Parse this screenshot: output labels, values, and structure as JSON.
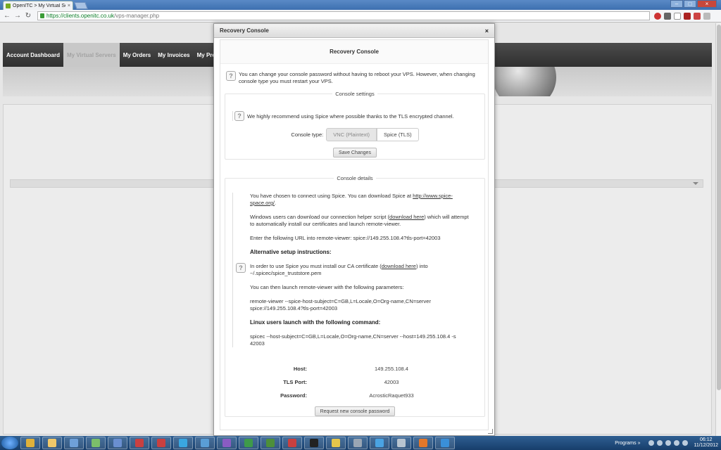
{
  "browser": {
    "tab_title": "OpenITC > My Virtual Serv",
    "tab_close": "×",
    "url_host": "https://clients.openitc.co.uk",
    "url_path": "/vps-manager.php",
    "back": "←",
    "forward": "→",
    "reload": "↻",
    "minimize": "–",
    "maximize": "□",
    "close": "×"
  },
  "nav": {
    "items": [
      {
        "label": "Account Dashboard"
      },
      {
        "label": "My Virtual Servers"
      },
      {
        "label": "My Orders"
      },
      {
        "label": "My Invoices"
      },
      {
        "label": "My Pref"
      }
    ]
  },
  "modal": {
    "header_title": "Recovery Console",
    "close": "×",
    "inner_title": "Recovery Console",
    "intro": "You can change your console password without having to reboot your VPS. However, when changing console type you must restart your VPS.",
    "info_glyph": "?",
    "settings": {
      "legend": "Console settings",
      "recommend": "We highly recommend using Spice where possible thanks to the TLS encrypted channel.",
      "type_label": "Console type:",
      "option_vnc": "VNC (Plaintext)",
      "option_spice": "Spice (TLS)",
      "save_label": "Save Changes"
    },
    "details": {
      "legend": "Console details",
      "p1_pre": "You have chosen to connect using Spice. You can download Spice at ",
      "p1_link": "http://www.spice-space.org/",
      "p1_post": ".",
      "p2_pre": "Windows users can download our connection helper script (",
      "p2_link": "download here",
      "p2_post": ") which will attempt to automatically install our certificates and launch remote-viewer.",
      "p3": "Enter the following URL into remote-viewer: spice://149.255.108.4?tls-port=42003",
      "h_alt": "Alternative setup instructions:",
      "p4_pre": "In order to use Spice you must install our CA certificate (",
      "p4_link": "download here",
      "p4_post": ") into ~/.spicec/spice_truststore.pem",
      "p5": "You can then launch remote-viewer with the following parameters:",
      "p6": "remote-viewer --spice-host-subject=C=GB,L=Locale,O=Org-name,CN=server spice://149.255.108.4?tls-port=42003",
      "h_linux": "Linux users launch with the following command:",
      "p7": "spicec --host-subject=C=GB,L=Locale,O=Org-name,CN=server --host=149.255.108.4 -s 42003",
      "host_label": "Host:",
      "host_value": "149.255.108.4",
      "port_label": "TLS Port:",
      "port_value": "42003",
      "password_label": "Password:",
      "password_value": "AcrosticRaquet933",
      "request_label": "Request new console password"
    }
  },
  "taskbar": {
    "programs_label": "Programs",
    "programs_arrow": "»",
    "time": "06:12",
    "date": "11/12/2012",
    "apps": [
      {
        "name": "chrome",
        "color": "#e0b13a"
      },
      {
        "name": "explorer",
        "color": "#f0c86a"
      },
      {
        "name": "remote-desktop",
        "color": "#6fa0d8"
      },
      {
        "name": "network",
        "color": "#7bbf6a"
      },
      {
        "name": "installer",
        "color": "#6a8fd0"
      },
      {
        "name": "app-red-1",
        "color": "#c94040"
      },
      {
        "name": "app-red-2",
        "color": "#c94040"
      },
      {
        "name": "skype",
        "color": "#3aa6e0"
      },
      {
        "name": "messenger",
        "color": "#5a9ed6"
      },
      {
        "name": "visual-studio",
        "color": "#8a5cc2"
      },
      {
        "name": "excel",
        "color": "#3e9a4a"
      },
      {
        "name": "project",
        "color": "#4d8f3a"
      },
      {
        "name": "app-red-3",
        "color": "#c94040"
      },
      {
        "name": "terminal",
        "color": "#222222"
      },
      {
        "name": "notepad",
        "color": "#e6c64b"
      },
      {
        "name": "tools",
        "color": "#9aa6b4"
      },
      {
        "name": "twitter",
        "color": "#4aa3e2"
      },
      {
        "name": "app-window",
        "color": "#b8c4d0"
      },
      {
        "name": "firefox",
        "color": "#e2772a"
      },
      {
        "name": "ie",
        "color": "#3a8fd8"
      }
    ]
  }
}
